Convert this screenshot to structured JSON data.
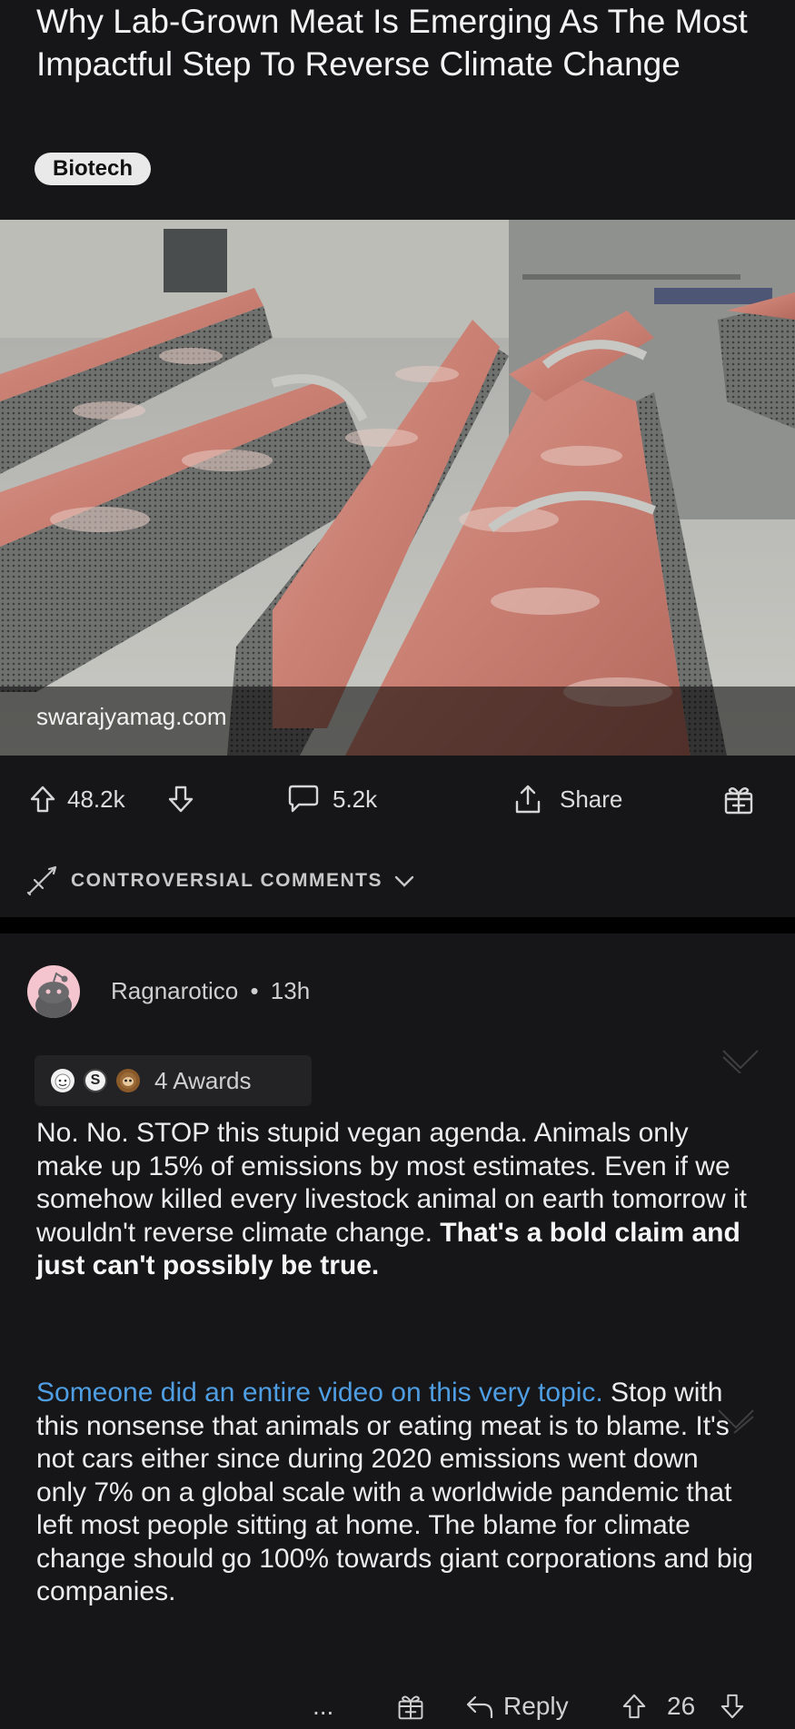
{
  "post": {
    "title": "Why Lab-Grown Meat Is Emerging As The Most Impactful Step To Reverse Climate Change",
    "flair": "Biotech",
    "source_domain": "swarajyamag.com",
    "image_icon": "meat-conveyor-photo"
  },
  "actions": {
    "upvotes": "48.2k",
    "comments": "5.2k",
    "share_label": "Share",
    "upvote_icon": "arrow-up-icon",
    "downvote_icon": "arrow-down-icon",
    "comment_icon": "speech-bubble-icon",
    "share_icon": "share-icon",
    "award_icon": "gift-icon"
  },
  "sort": {
    "label": "CONTROVERSIAL COMMENTS",
    "icon": "sword-icon"
  },
  "comment": {
    "author": "Ragnarotico",
    "separator": "•",
    "time": "13h",
    "awards_label": "4 Awards",
    "award_badge_2": "S",
    "paragraph1_plain": "No. No. STOP this stupid vegan agenda. Animals only make up 15% of emissions by most estimates. Even if we somehow killed every livestock animal on earth tomorrow it wouldn't reverse climate change. ",
    "paragraph1_bold": "That's a bold claim and just can't possibly be true.",
    "paragraph2_link": "Someone did an entire video on this very topic.",
    "paragraph2_plain": " Stop with this nonsense that animals or eating meat is to blame. It's not cars either since during 2020 emissions went down only 7% on a global scale with a worldwide pandemic that left  most people sitting at home. The blame for climate change should go 100% towards giant corporations and big companies.",
    "more_label": "...",
    "reply_label": "Reply",
    "score": "26",
    "colors": {
      "link": "#4f9ee3",
      "avatar_bg": "#f4c5cf"
    }
  }
}
